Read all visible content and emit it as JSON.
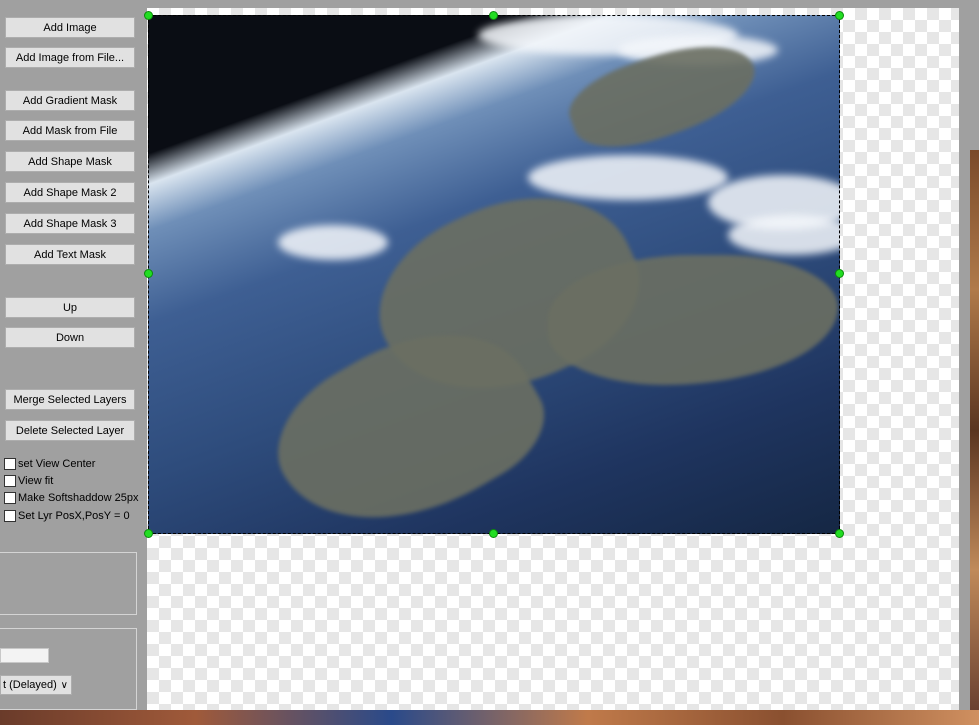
{
  "toolbar": {
    "add_image": "Add Image",
    "add_image_from_file": "Add Image from File...",
    "add_gradient_mask": "Add Gradient Mask",
    "add_mask_from_file": "Add Mask from File",
    "add_shape_mask": "Add Shape Mask",
    "add_shape_mask_2": "Add Shape Mask 2",
    "add_shape_mask_3": "Add Shape Mask 3",
    "add_text_mask": "Add Text Mask",
    "up": "Up",
    "down": "Down",
    "merge_selected_layers": "Merge Selected Layers",
    "delete_selected_layer": "Delete Selected Layer"
  },
  "options": {
    "set_view_center": "set View Center",
    "view_fit": "View fit",
    "make_softshadow": "Make Softshaddow 25px",
    "set_lyr_pos": "Set Lyr PosX,PosY = 0"
  },
  "bottom": {
    "text_value": "",
    "select_value": "t (Delayed)"
  },
  "colors": {
    "panel_bg": "#a0a0a0",
    "button_bg": "#e1e1e1",
    "handle": "#22dd22"
  }
}
